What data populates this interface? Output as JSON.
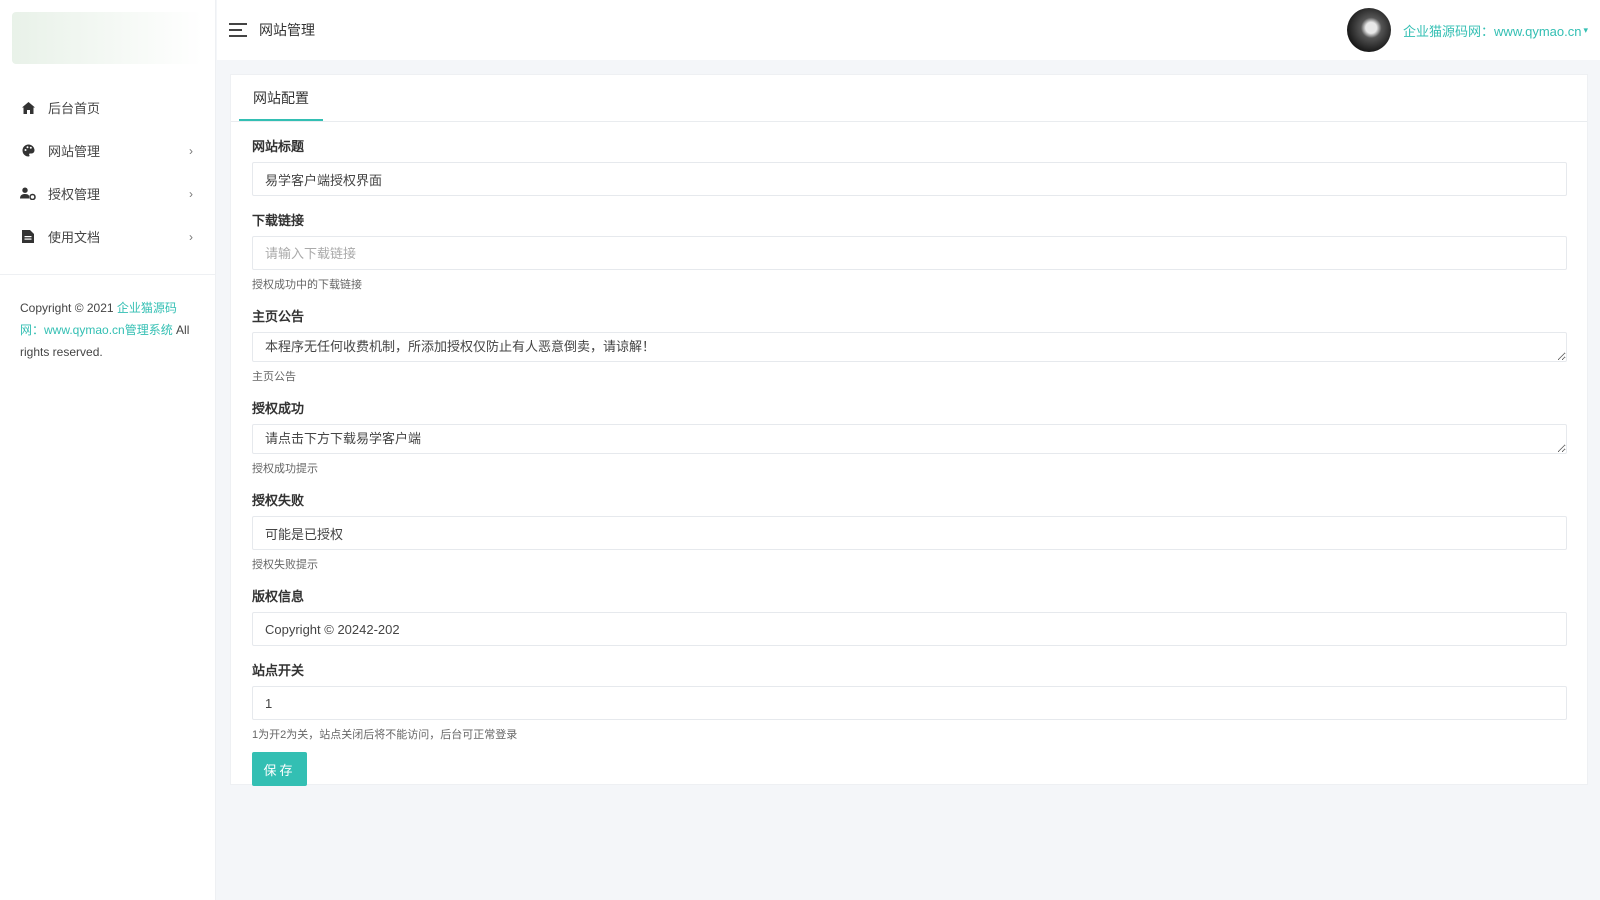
{
  "sidebar": {
    "items": [
      {
        "label": "后台首页",
        "icon": "home-icon",
        "has_arrow": false
      },
      {
        "label": "网站管理",
        "icon": "palette-icon",
        "has_arrow": true
      },
      {
        "label": "授权管理",
        "icon": "user-gear-icon",
        "has_arrow": true
      },
      {
        "label": "使用文档",
        "icon": "document-icon",
        "has_arrow": true
      }
    ],
    "arrow": "›",
    "copyright_prefix": "Copyright © 2021 ",
    "copyright_link": "企业猫源码网：www.qymao.cn管理系统",
    "copyright_suffix": " All rights reserved."
  },
  "header": {
    "title": "网站管理",
    "user_link": "企业猫源码网：www.qymao.cn",
    "caret": "▾"
  },
  "main": {
    "tab": "网站配置",
    "fields": {
      "site_title": {
        "label": "网站标题",
        "value": "易学客户端授权界面"
      },
      "download_link": {
        "label": "下载链接",
        "placeholder": "请输入下载链接",
        "help": "授权成功中的下载链接"
      },
      "announcement": {
        "label": "主页公告",
        "value": "本程序无任何收费机制，所添加授权仅防止有人恶意倒卖，请谅解！",
        "help": "主页公告"
      },
      "auth_success": {
        "label": "授权成功",
        "value": "请点击下方下载易学客户端",
        "help": "授权成功提示"
      },
      "auth_fail": {
        "label": "授权失败",
        "value": "可能是已授权",
        "help": "授权失败提示"
      },
      "copyright": {
        "label": "版权信息",
        "value": "Copyright © 20242-202"
      },
      "site_switch": {
        "label": "站点开关",
        "value": "1",
        "help": "1为开2为关，站点关闭后将不能访问，后台可正常登录"
      }
    },
    "save_label": "保存"
  },
  "colors": {
    "accent": "#33bfb3"
  }
}
